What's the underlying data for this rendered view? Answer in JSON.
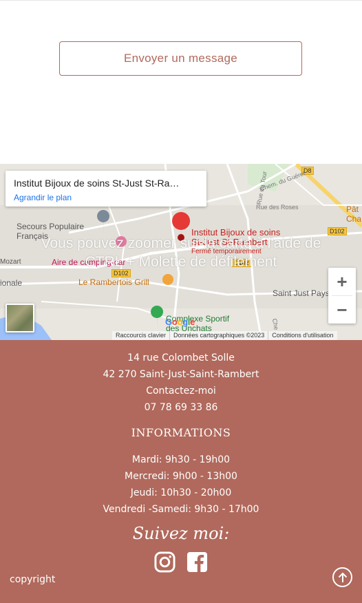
{
  "contact": {
    "send_button_label": "Envoyer un message"
  },
  "map": {
    "place_title": "Institut Bijoux de soins St-Just St-Ra…",
    "enlarge_link": "Agrandir le plan",
    "overlay_text_line1": "Vous pouvez zoomer sur la carte à l'aide de",
    "overlay_text_line2": "CTRL + Molette de défilement",
    "marker_name_line1": "Institut Bijoux de soins",
    "marker_name_line2": "St-Just St-Rambert",
    "marker_status": "Fermé temporairement",
    "labels": {
      "secours": "Secours Populaire\nFrançais",
      "camping": "Aire de camping-car",
      "grill": "Le Rambertois Grill",
      "complexe": "Complexe Sportif\ndes Unchats",
      "saint_just": "Saint Just Paysag",
      "mozart": "Mozart",
      "regional": "ionale",
      "pat": "Pât\nCha",
      "road1": "Chem. du Guéret",
      "road2": "Rue des Roses",
      "road3": "Rue du Tour",
      "road4": "Che"
    },
    "road_badges": [
      "D8",
      "D102",
      "D102",
      "D102"
    ],
    "zoom_in": "+",
    "zoom_out": "−",
    "footer_shortcuts": "Raccourcis clavier",
    "footer_data": "Données cartographiques ©2023",
    "footer_terms": "Conditions d'utilisation",
    "google": "Google"
  },
  "footer": {
    "address_line1": "14 rue Colombet Solle",
    "address_line2": "42 270 Saint-Just-Saint-Rambert",
    "contact_link": "Contactez-moi",
    "phone": "07 78 69 33 86",
    "info_heading": "INFORMATIONS",
    "hours": [
      "Mardi: 9h30 - 19h00",
      "Mercredi: 9h00 - 13h00",
      "Jeudi: 10h30 - 20h00",
      "Vendredi -Samedi: 9h30 - 17h00"
    ],
    "follow": "Suivez moi:",
    "copyright": "copyright",
    "bg_color": "#b0695c"
  }
}
